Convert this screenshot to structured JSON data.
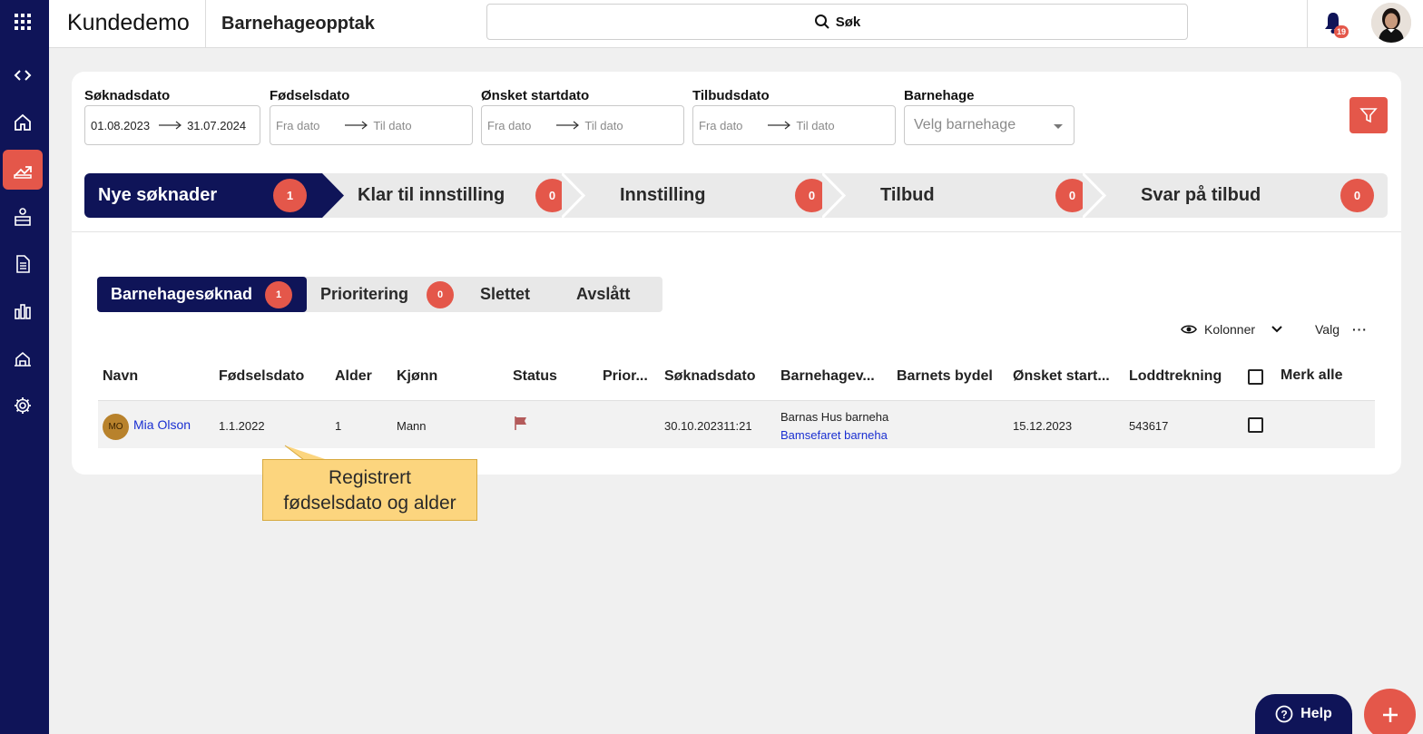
{
  "app": {
    "name": "Kundedemo",
    "page_title": "Barnehageopptak"
  },
  "search": {
    "label": "Søk"
  },
  "notifications": {
    "count": "19"
  },
  "sidebar": {
    "items": [
      {
        "icon": "code-icon"
      },
      {
        "icon": "home-icon"
      },
      {
        "icon": "admission-icon",
        "active": true
      },
      {
        "icon": "kindergarten-icon"
      },
      {
        "icon": "document-icon"
      },
      {
        "icon": "report-icon"
      },
      {
        "icon": "building-icon"
      },
      {
        "icon": "settings-icon"
      }
    ]
  },
  "filters": {
    "soknadsdato": {
      "label": "Søknadsdato",
      "from": "01.08.2023",
      "to": "31.07.2024"
    },
    "fodselsdato": {
      "label": "Fødselsdato",
      "from_placeholder": "Fra dato",
      "to_placeholder": "Til dato"
    },
    "onsket_startdato": {
      "label": "Ønsket startdato",
      "from_placeholder": "Fra dato",
      "to_placeholder": "Til dato"
    },
    "tilbudsdato": {
      "label": "Tilbudsdato",
      "from_placeholder": "Fra dato",
      "to_placeholder": "Til dato"
    },
    "barnehage": {
      "label": "Barnehage",
      "placeholder": "Velg barnehage"
    }
  },
  "steps": [
    {
      "label": "Nye søknader",
      "count": "1"
    },
    {
      "label": "Klar til innstilling",
      "count": "0"
    },
    {
      "label": "Innstilling",
      "count": "0"
    },
    {
      "label": "Tilbud",
      "count": "0"
    },
    {
      "label": "Svar på tilbud",
      "count": "0"
    }
  ],
  "subtabs": [
    {
      "label": "Barnehagesøknad",
      "count": "1"
    },
    {
      "label": "Prioritering",
      "count": "0"
    },
    {
      "label": "Slettet"
    },
    {
      "label": "Avslått"
    }
  ],
  "controls": {
    "columns": "Kolonner",
    "options": "Valg"
  },
  "table": {
    "headers": [
      "Navn",
      "Fødselsdato",
      "Alder",
      "Kjønn",
      "Status",
      "Prior...",
      "Søknadsdato",
      "Barnehagev...",
      "Barnets bydel",
      "Ønsket start...",
      "Loddtrekning",
      "Merk alle"
    ],
    "rows": [
      {
        "initials": "MO",
        "name": "Mia Olson",
        "birthdate": "1.1.2022",
        "age": "1",
        "gender": "Mann",
        "status": "flag-icon",
        "application_date": "30.10.202311:21",
        "kindergarten_1": "Barnas Hus barneha",
        "kindergarten_2": "Bamsefaret barneha",
        "start_date": "15.12.2023",
        "lottery": "543617"
      }
    ]
  },
  "callout": {
    "line1": "Registrert",
    "line2": "fødselsdato og alder"
  },
  "help": {
    "label": "Help"
  },
  "colors": {
    "navy": "#0f1458",
    "accent": "#e4574a",
    "callout": "#fcd57e"
  }
}
